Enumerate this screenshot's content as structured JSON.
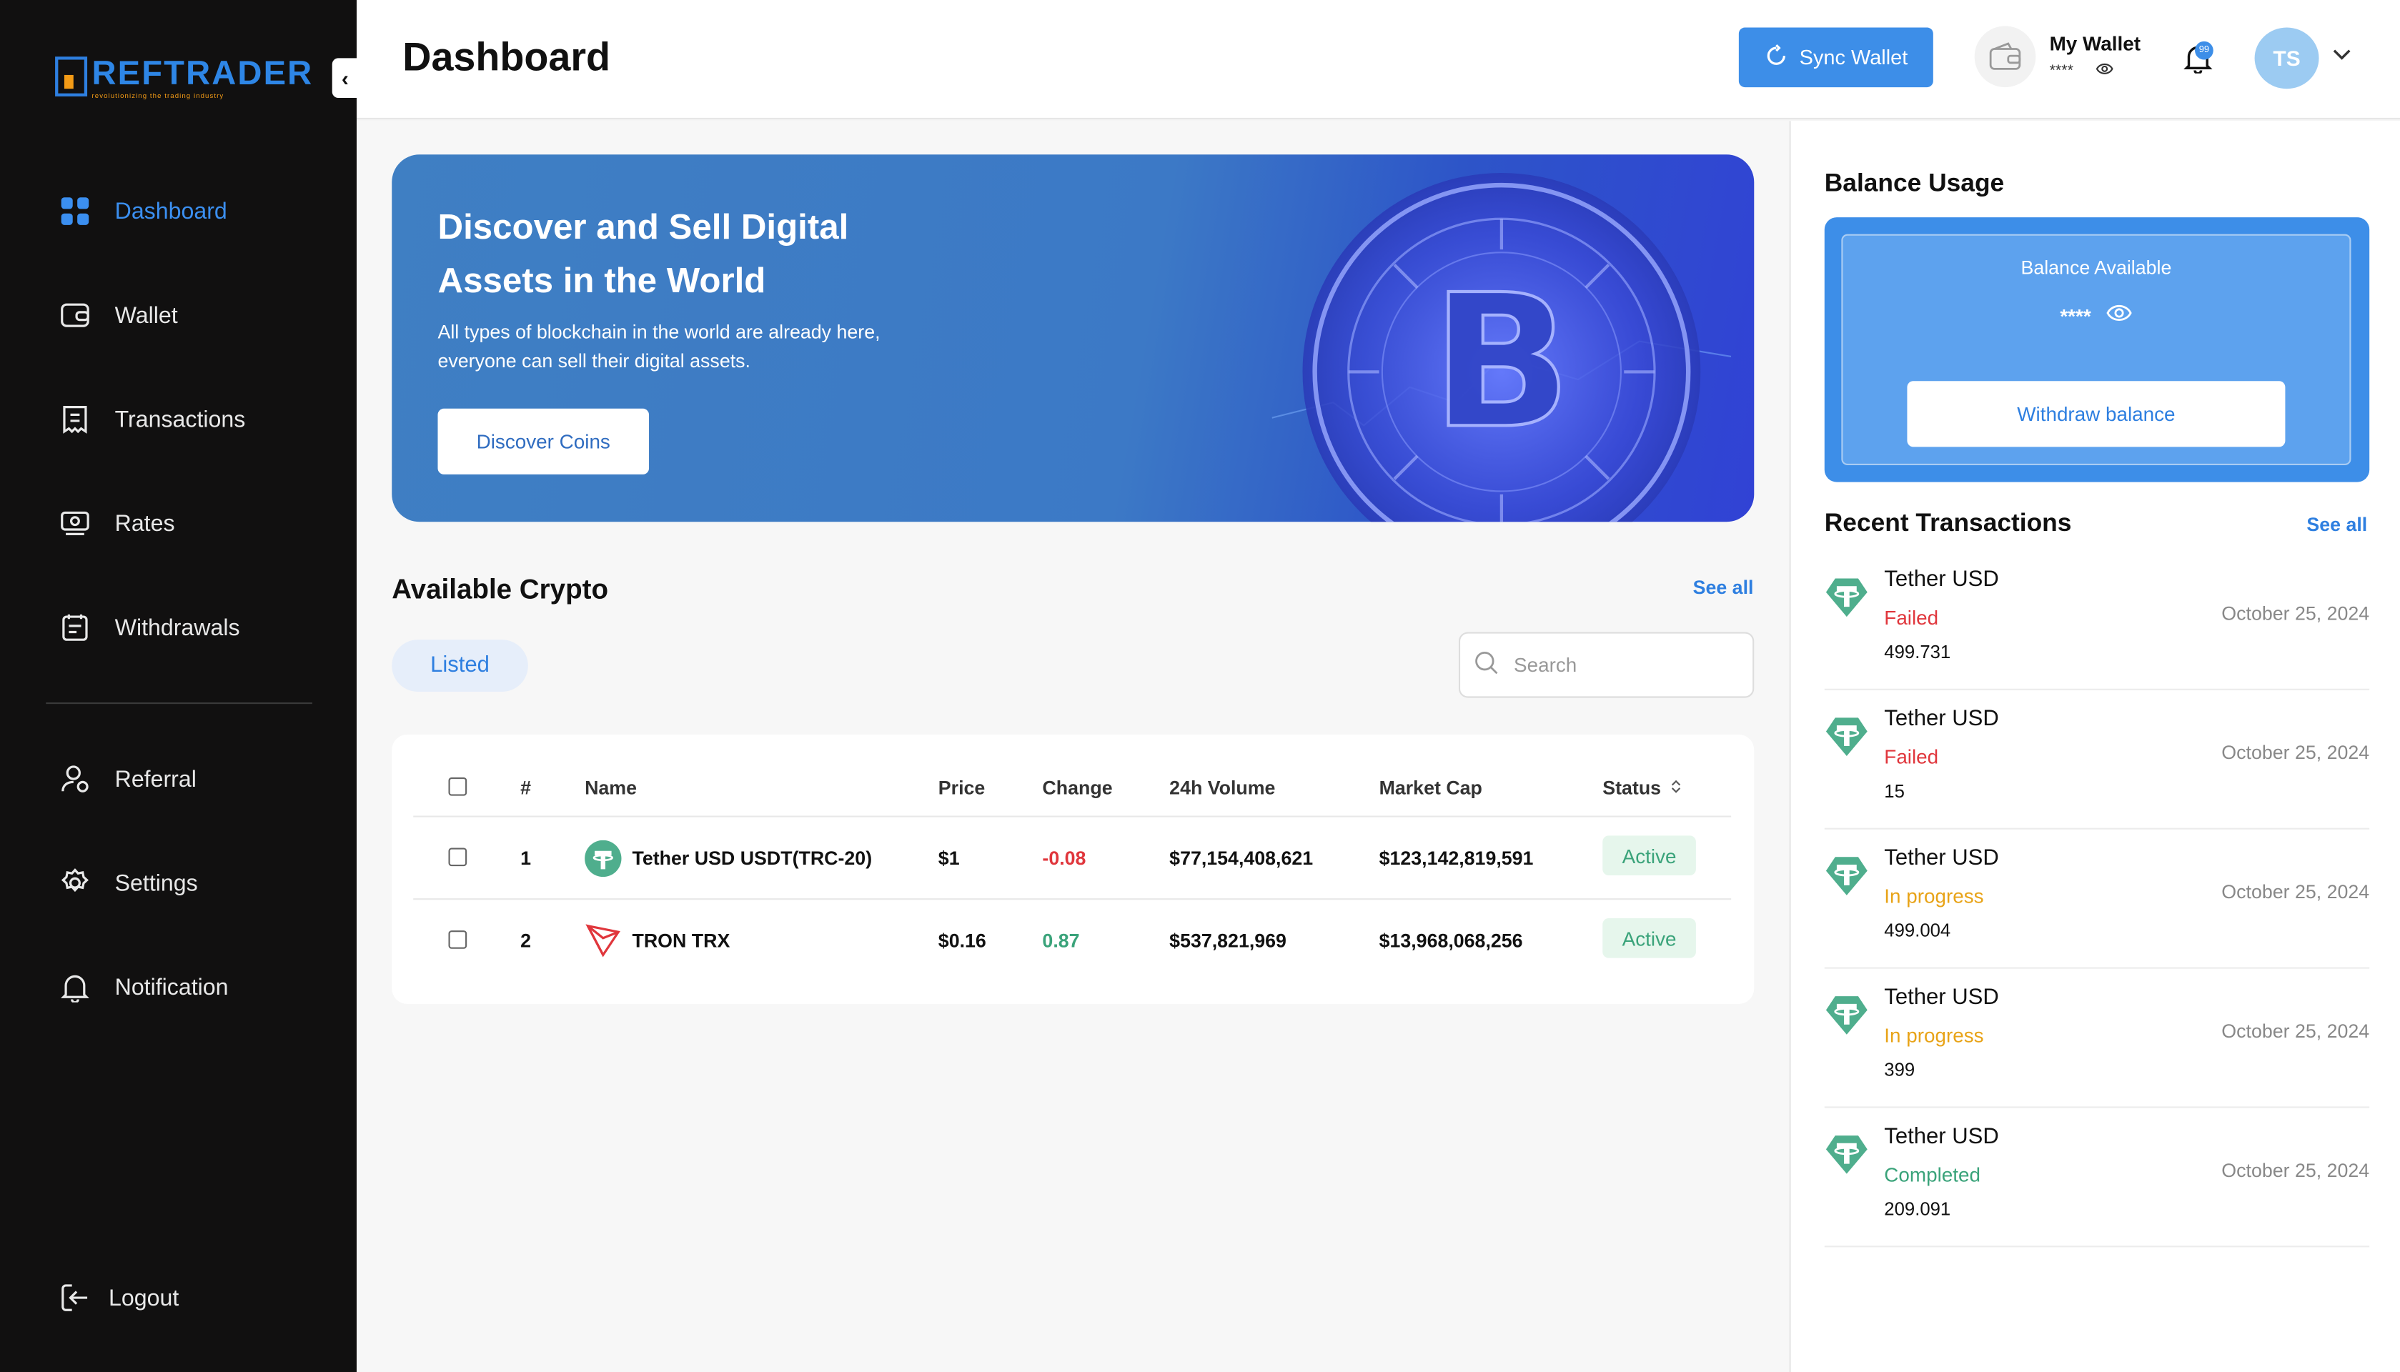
{
  "brand": {
    "name": "REFTRADER",
    "tagline": "revolutionizing the trading industry"
  },
  "sidebar": {
    "items": [
      {
        "label": "Dashboard",
        "icon": "dashboard-grid-icon",
        "active": true
      },
      {
        "label": "Wallet",
        "icon": "wallet-icon"
      },
      {
        "label": "Transactions",
        "icon": "receipt-icon"
      },
      {
        "label": "Rates",
        "icon": "rates-icon"
      },
      {
        "label": "Withdrawals",
        "icon": "withdrawals-icon"
      },
      {
        "label": "Referral",
        "icon": "user-referral-icon"
      },
      {
        "label": "Settings",
        "icon": "gear-icon"
      },
      {
        "label": "Notification",
        "icon": "bell-icon"
      }
    ],
    "logout": "Logout"
  },
  "header": {
    "title": "Dashboard",
    "sync_label": "Sync Wallet",
    "wallet_label": "My Wallet",
    "wallet_mask": "****",
    "notification_count": "99",
    "avatar_initials": "TS"
  },
  "banner": {
    "title": "Discover and Sell Digital Assets in the World",
    "subtitle": "All types of blockchain in the world are already here, everyone can sell their digital assets.",
    "button": "Discover Coins"
  },
  "crypto": {
    "title": "Available Crypto",
    "see_all": "See all",
    "tab": "Listed",
    "search_placeholder": "Search",
    "columns": [
      "#",
      "Name",
      "Price",
      "Change",
      "24h Volume",
      "Market Cap",
      "Status"
    ],
    "rows": [
      {
        "num": "1",
        "name": "Tether USD USDT(TRC-20)",
        "icon": "tether-icon",
        "price": "$1",
        "change": "-0.08",
        "volume": "$77,154,408,621",
        "cap": "$123,142,819,591",
        "status": "Active"
      },
      {
        "num": "2",
        "name": "TRON TRX",
        "icon": "tron-icon",
        "price": "$0.16",
        "change": "0.87",
        "volume": "$537,821,969",
        "cap": "$13,968,068,256",
        "status": "Active"
      }
    ]
  },
  "balance": {
    "title": "Balance Usage",
    "label": "Balance Available",
    "mask": "****",
    "withdraw": "Withdraw balance"
  },
  "recent": {
    "title": "Recent Transactions",
    "see_all": "See all",
    "items": [
      {
        "name": "Tether USD",
        "status": "Failed",
        "amount": "499.731",
        "date": "October 25, 2024"
      },
      {
        "name": "Tether USD",
        "status": "Failed",
        "amount": "15",
        "date": "October 25, 2024"
      },
      {
        "name": "Tether USD",
        "status": "In progress",
        "amount": "499.004",
        "date": "October 25, 2024"
      },
      {
        "name": "Tether USD",
        "status": "In progress",
        "amount": "399",
        "date": "October 25, 2024"
      },
      {
        "name": "Tether USD",
        "status": "Completed",
        "amount": "209.091",
        "date": "October 25, 2024"
      }
    ]
  },
  "colors": {
    "accent": "#3d8ee8",
    "sidebar": "#111010",
    "failed": "#e0363c",
    "progress": "#e8a317",
    "completed": "#3aa37a"
  }
}
